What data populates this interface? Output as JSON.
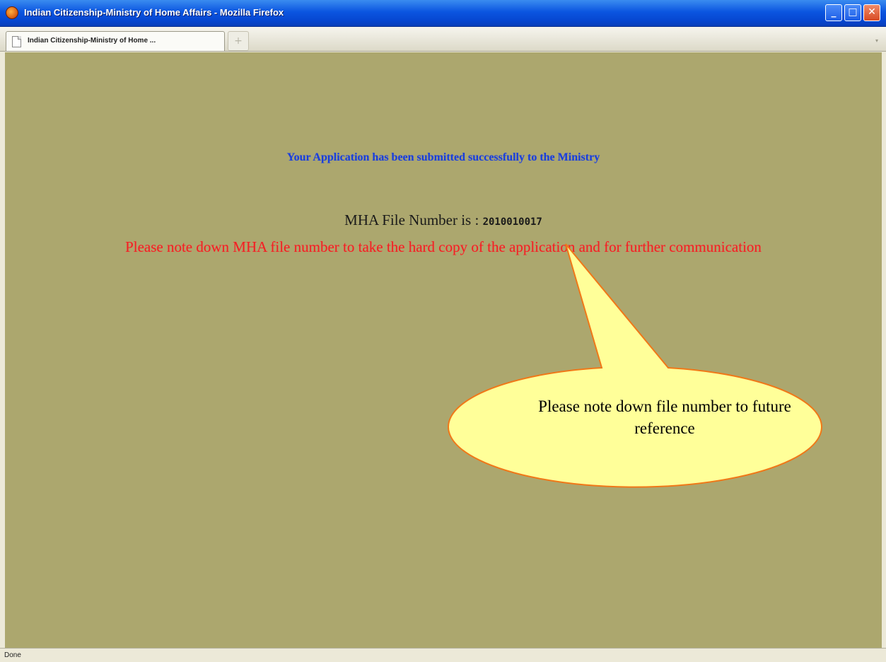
{
  "window": {
    "title": "Indian Citizenship-Ministry of Home Affairs - Mozilla Firefox",
    "controls": {
      "minimize": "_",
      "maximize": "□",
      "close": "✕"
    }
  },
  "tabs": {
    "active_label": "Indian Citizenship-Ministry of Home ...",
    "new_tab": "+",
    "scroll": "▾"
  },
  "page": {
    "success_message": "Your Application has been submitted successfully to the Ministry",
    "file_number_label": "MHA File Number is : ",
    "file_number_value": "2010010017",
    "note_message": "Please note down MHA file number to take the hard copy of the application and for further communication"
  },
  "callout": {
    "text": "Please note down file number to future reference",
    "fill_color": "#ffff99",
    "border_color": "#f07818"
  },
  "status": {
    "text": "Done"
  },
  "colors": {
    "page_background": "#aca76e",
    "success_text": "#1a3fd8",
    "note_text": "#ee2222",
    "titlebar": "#0b55e0"
  }
}
